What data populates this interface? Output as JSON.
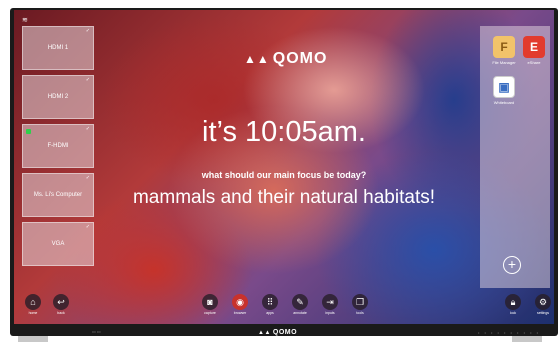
{
  "brand": {
    "logo_text": "QOMO",
    "logo_icon": "qomo-logo-icon"
  },
  "status_bar": {
    "wifi_icon": "wifi-icon"
  },
  "sources": [
    {
      "label": "HDMI 1",
      "active": false
    },
    {
      "label": "HDMI 2",
      "active": false
    },
    {
      "label": "F-HDMI",
      "active": true
    },
    {
      "label": "Ms. Li's Computer",
      "active": false
    },
    {
      "label": "VGA",
      "active": false
    }
  ],
  "source_check_icon": "checkmark-icon",
  "clock": {
    "text": "it’s 10:05am."
  },
  "focus": {
    "question": "what should our main focus be today?",
    "answer": "mammals and their natural habitats!"
  },
  "apps": [
    {
      "label": "File Manager",
      "icon": "file-manager-icon"
    },
    {
      "label": "eShare",
      "icon": "eshare-icon"
    },
    {
      "label": "Whiteboard",
      "icon": "whiteboard-icon"
    }
  ],
  "add_app_icon": "plus-icon",
  "dock": {
    "home": {
      "label": "home",
      "icon": "home-icon"
    },
    "back": {
      "label": "back",
      "icon": "back-icon"
    },
    "capture": {
      "label": "capture",
      "icon": "camera-icon"
    },
    "browser": {
      "label": "browser",
      "icon": "browser-icon"
    },
    "apps": {
      "label": "apps",
      "icon": "apps-grid-icon"
    },
    "annotate": {
      "label": "annotate",
      "icon": "pen-icon"
    },
    "inputs": {
      "label": "inputs",
      "icon": "input-icon"
    },
    "tools": {
      "label": "tools",
      "icon": "tools-icon"
    },
    "lock": {
      "label": "lock",
      "icon": "lock-icon"
    },
    "settings": {
      "label": "settings",
      "icon": "gear-icon"
    }
  },
  "bezel": {
    "logo_text": "QOMO"
  },
  "colors": {
    "active_source": "#2ed14a",
    "browser_accent": "#c8322c",
    "eshare_red": "#e23b2e"
  }
}
